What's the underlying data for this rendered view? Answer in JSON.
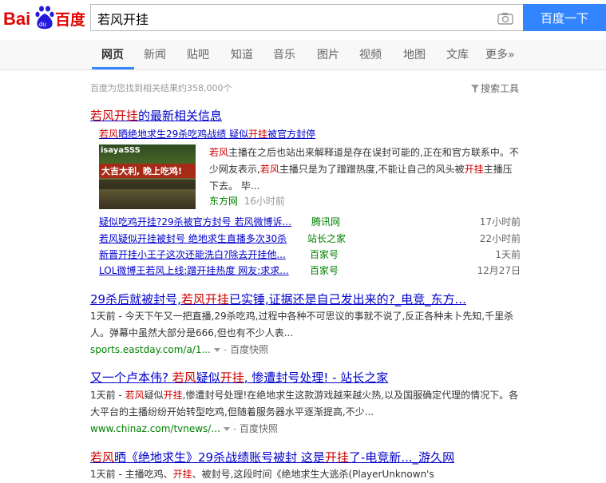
{
  "header": {
    "logo_text": "Bai百度",
    "search_query": "若风开挂",
    "search_button": "百度一下"
  },
  "tabs": [
    "网页",
    "新闻",
    "贴吧",
    "知道",
    "音乐",
    "图片",
    "视频",
    "地图",
    "文库",
    "更多»"
  ],
  "result_count": "百度为您找到相关结果约358,000个",
  "search_tools": "搜索工具",
  "results": {
    "news_block": {
      "title_red": "若风开挂",
      "title_rest": "的最新相关信息",
      "sub_title_parts": [
        "若风",
        "晒绝地求生29杀吃鸡战绩 疑似",
        "开挂",
        "被官方封停"
      ],
      "thumb_text1": "isayaSSS",
      "thumb_text2": "大吉大利, 晚上吃鸡!",
      "snippet_parts": [
        "若风",
        "主播在之后也站出来解释道是存在误封可能的,正在和官方联系中。不少网友表示,",
        "若风",
        "主播只是为了蹭蹭热度,不能让自己的风头被",
        "开挂",
        "主播压下去。 毕..."
      ],
      "source": "东方网",
      "time": "16小时前",
      "rows": [
        {
          "title": "疑似吃鸡开挂?29杀被官方封号 若风微博诉...",
          "source": "腾讯网",
          "time": "17小时前"
        },
        {
          "title": "若风疑似开挂被封号 绝地求生直播多次30杀",
          "source": "站长之家",
          "time": "22小时前"
        },
        {
          "title": "新晋开挂小王子这次还能洗白?除去开挂他...",
          "source": "百家号",
          "time": "1天前"
        },
        {
          "title": "LOL微博王若风上线:蹭开挂热度 网友:求求...",
          "source": "百家号",
          "time": "12月27日"
        }
      ]
    },
    "result2": {
      "title_parts": [
        "29杀后就被封号,",
        "若风开挂",
        "已实锤,证据还是自己发出来的?_电竞_东方..."
      ],
      "snippet": "1天前 - 今天下午又一把直播,29杀吃鸡,过程中各种不可思议的事就不说了,反正各种未卜先知,千里杀人。弹幕中虽然大部分是666,但也有不少人表...",
      "url": "sports.eastday.com/a/1...",
      "snapshot": "百度快照"
    },
    "result3": {
      "title_parts": [
        "又一个卢本伟? ",
        "若风",
        "疑似",
        "开挂",
        ", 惨遭封号处理! - 站长之家"
      ],
      "snippet_parts": [
        "1天前 - ",
        "若风",
        "疑似",
        "开挂",
        ",惨遭封号处理!在绝地求生这款游戏越来越火热,以及国服确定代理的情况下。各大平台的主播纷纷开始转型吃鸡,但随着服务器水平逐渐提高,不少..."
      ],
      "url": "www.chinaz.com/tvnews/...",
      "snapshot": "百度快照"
    },
    "result4": {
      "title_parts": [
        "若风",
        "晒《绝地求生》29杀战绩账号被封 这是",
        "开挂",
        "了-电竞新..._游久网"
      ],
      "snippet_parts": [
        "1天前 - 主播吃鸡、",
        "开挂",
        "、被封号,这段时间《绝地求生大逃杀(PlayerUnknown's"
      ]
    }
  },
  "colors": {
    "accent": "#3385ff",
    "link": "#0000cc",
    "highlight": "#cc0000",
    "source": "#008000"
  }
}
